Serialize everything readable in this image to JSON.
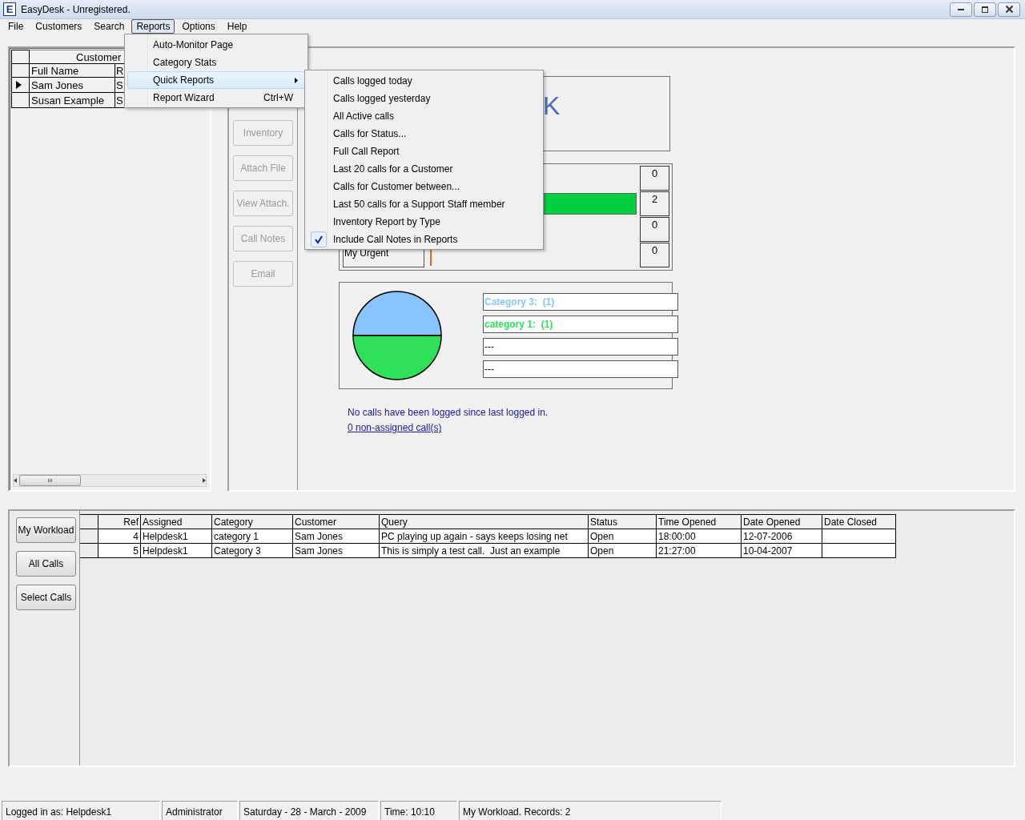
{
  "window": {
    "icon": "E",
    "title": "EasyDesk - Unregistered."
  },
  "menu_bar": [
    {
      "label": "File",
      "selected": false
    },
    {
      "label": "Customers",
      "selected": false
    },
    {
      "label": "Search",
      "selected": false
    },
    {
      "label": "Reports",
      "selected": true
    },
    {
      "label": "Options",
      "selected": false
    },
    {
      "label": "Help",
      "selected": false
    }
  ],
  "reports_menu": [
    {
      "label": "Auto-Monitor Page",
      "selected": false
    },
    {
      "label": "Category Stats",
      "selected": false
    },
    {
      "label": "Quick Reports",
      "selected": true,
      "submenu": true
    },
    {
      "label": "Report Wizard",
      "shortcut": "Ctrl+W",
      "selected": false
    }
  ],
  "quick_reports_menu": [
    {
      "label": "Calls logged today",
      "checked": false
    },
    {
      "label": "Calls logged yesterday",
      "checked": false
    },
    {
      "label": "All Active calls",
      "checked": false
    },
    {
      "label": "Calls for Status...",
      "checked": false
    },
    {
      "label": "Full Call Report",
      "checked": false
    },
    {
      "label": "Last 20 calls for a Customer",
      "checked": false
    },
    {
      "label": "Calls for Customer between...",
      "checked": false
    },
    {
      "label": "Last 50 calls for a Support Staff member",
      "checked": false
    },
    {
      "label": "Inventory Report by Type",
      "checked": false
    },
    {
      "label": "Include Call Notes in Reports",
      "checked": true
    }
  ],
  "customer_grid": {
    "title": "Customer",
    "columns": [
      "Full Name",
      "R"
    ],
    "rows": [
      {
        "cells": [
          "Sam Jones",
          "S"
        ],
        "selected": true
      },
      {
        "cells": [
          "Susan Example",
          "S"
        ],
        "selected": false
      }
    ]
  },
  "call_buttons": [
    {
      "label": "Inventory",
      "disabled": true
    },
    {
      "label": "Attach File",
      "disabled": true
    },
    {
      "label": "View Attach.",
      "disabled": true
    },
    {
      "label": "Call Notes",
      "disabled": true
    },
    {
      "label": "Email",
      "disabled": true
    }
  ],
  "logo_text": "K",
  "stats": [
    {
      "count": "0"
    },
    {
      "count": "2",
      "level": 1,
      "color": "#00d040"
    },
    {
      "count": "0"
    },
    {
      "label": "My Urgent",
      "count": "0",
      "color": "#e07020"
    }
  ],
  "category_chart": {
    "chart_data": {
      "type": "pie",
      "categories": [
        "Category 3:  (1)",
        "category 1:  (1)"
      ],
      "values": [
        1,
        1
      ]
    },
    "slices": [
      {
        "color": "#88c4ff"
      },
      {
        "color": "#2ee05a"
      }
    ],
    "empty_rows": [
      "---",
      "---"
    ]
  },
  "messages": {
    "notice": "No calls have been logged since last logged in.",
    "link": "0 non-assigned call(s)"
  },
  "view_buttons": [
    {
      "label": "My Workload"
    },
    {
      "label": "All Calls"
    },
    {
      "label": "Select Calls"
    }
  ],
  "calls_table": {
    "columns": [
      "Ref",
      "Assigned",
      "Category",
      "Customer",
      "Query",
      "Status",
      "Time Opened",
      "Date Opened",
      "Date Closed"
    ],
    "rows": [
      {
        "cells": [
          "4",
          "Helpdesk1",
          "category 1",
          "Sam Jones",
          "PC playing up again - says keeps losing net",
          "Open",
          "18:00:00",
          "12-07-2006",
          ""
        ]
      },
      {
        "cells": [
          "5",
          "Helpdesk1",
          "Category 3",
          "Sam Jones",
          "This is simply a test call.  Just an example",
          "Open",
          "21:27:00",
          "10-04-2007",
          ""
        ]
      }
    ]
  },
  "status_bar": [
    "Logged in as: Helpdesk1",
    "Administrator",
    "Saturday - 28 - March - 2009",
    "Time: 10:10",
    "My Workload.  Records: 2"
  ]
}
